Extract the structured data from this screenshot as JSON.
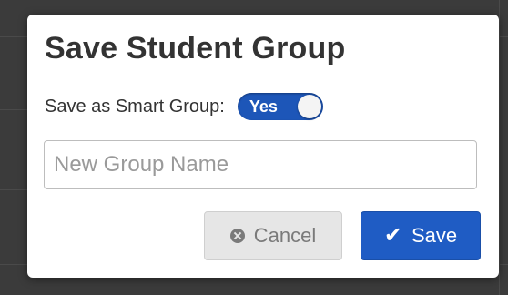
{
  "dialog": {
    "title": "Save Student Group",
    "smart_group": {
      "label": "Save as Smart Group:",
      "toggle_text": "Yes",
      "enabled": true
    },
    "group_name": {
      "value": "",
      "placeholder": "New Group Name"
    },
    "buttons": {
      "cancel_label": "Cancel",
      "save_label": "Save"
    }
  },
  "colors": {
    "accent": "#1f5cc4",
    "toggle_on": "#1d56b8",
    "overlay": "#3b3b3b"
  },
  "icons": {
    "cancel": "times-circle-icon",
    "save": "checkmark-icon"
  }
}
